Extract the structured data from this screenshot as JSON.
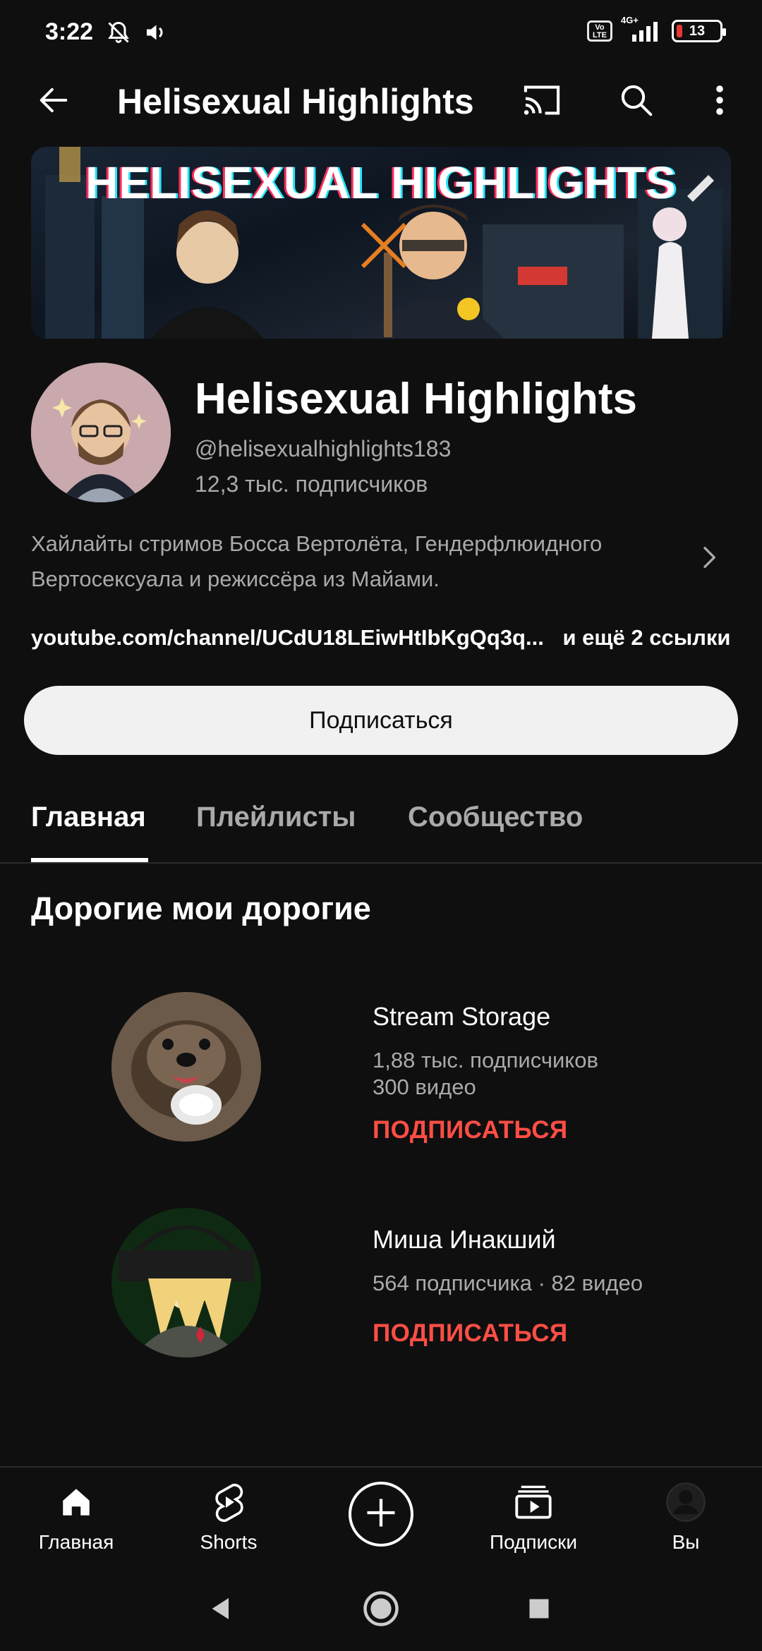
{
  "status_bar": {
    "time": "3:22",
    "volte": "Vo LTE",
    "network": "4G+",
    "battery_level": "13",
    "battery_color": "#e53935"
  },
  "app_bar": {
    "title": "Helisexual Highlights",
    "icons": [
      "back-arrow-icon",
      "cast-icon",
      "search-icon",
      "more-vert-icon"
    ]
  },
  "banner": {
    "title": "HELISEXUAL HIGHLIGHTS"
  },
  "channel": {
    "name": "Helisexual Highlights",
    "handle": "@helisexualhighlights183",
    "subscribers": "12,3 тыс. подписчиков",
    "description": "Хайлайты стримов Босса Вертолёта, Гендерфлюидного Вертосексуала и режиссёра из Майами.",
    "link": "youtube.com/channel/UCdU18LEiwHtIbKgQq3q...",
    "more_links": "и ещё 2 ссылки",
    "subscribe_label": "Подписаться"
  },
  "tabs": [
    {
      "label": "Главная",
      "active": true
    },
    {
      "label": "Плейлисты",
      "active": false
    },
    {
      "label": "Сообщество",
      "active": false
    }
  ],
  "section": {
    "title": "Дорогие мои дорогие",
    "channels": [
      {
        "name": "Stream Storage",
        "meta_line1": "1,88 тыс. подписчиков",
        "meta_line2": "300 видео",
        "subscribe_label": "ПОДПИСАТЬСЯ"
      },
      {
        "name": "Миша Инакший",
        "meta_line1": "564 подписчика · 82 видео",
        "subscribe_label": "ПОДПИСАТЬСЯ"
      }
    ]
  },
  "bottom_nav": [
    {
      "label": "Главная",
      "icon": "home-icon"
    },
    {
      "label": "Shorts",
      "icon": "shorts-icon"
    },
    {
      "label": "",
      "icon": "create-plus-icon"
    },
    {
      "label": "Подписки",
      "icon": "subscriptions-icon"
    },
    {
      "label": "Вы",
      "icon": "account-icon"
    }
  ],
  "colors": {
    "background": "#0f0f0f",
    "accent_red": "#ff4e45",
    "secondary_text": "#aaaaaa",
    "button_light": "#f1f1f1"
  }
}
